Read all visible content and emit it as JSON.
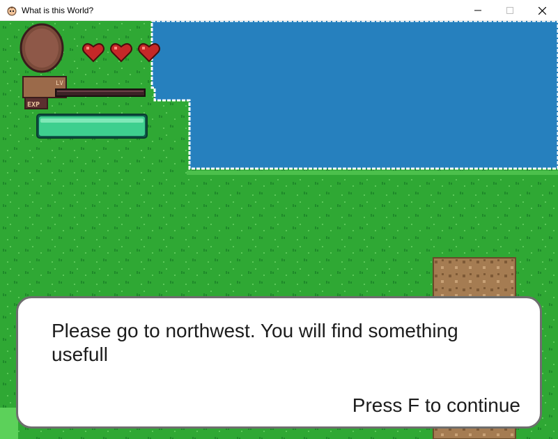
{
  "window": {
    "title": "What is this World?",
    "app_icon": "character-face-icon",
    "controls": [
      "minimize-icon",
      "maximize-icon",
      "close-icon"
    ]
  },
  "hud": {
    "hearts": {
      "current": 3,
      "max": 3,
      "icon": "heart-icon"
    },
    "level_label": "LV",
    "exp_label": "EXP",
    "exp_progress": 0,
    "stamina_progress": 1.0,
    "colors": {
      "heart": "#c62828",
      "stamina": "#3ecf8e",
      "exp_bar": "#3b2226"
    }
  },
  "dialog": {
    "message": "Please go to northwest. You will find something usefull",
    "prompt": "Press F to continue"
  },
  "colors": {
    "grass": "#2fa834",
    "water": "#2680be",
    "dirt": "#a57c52",
    "dialog_border": "#6e6e6e"
  }
}
